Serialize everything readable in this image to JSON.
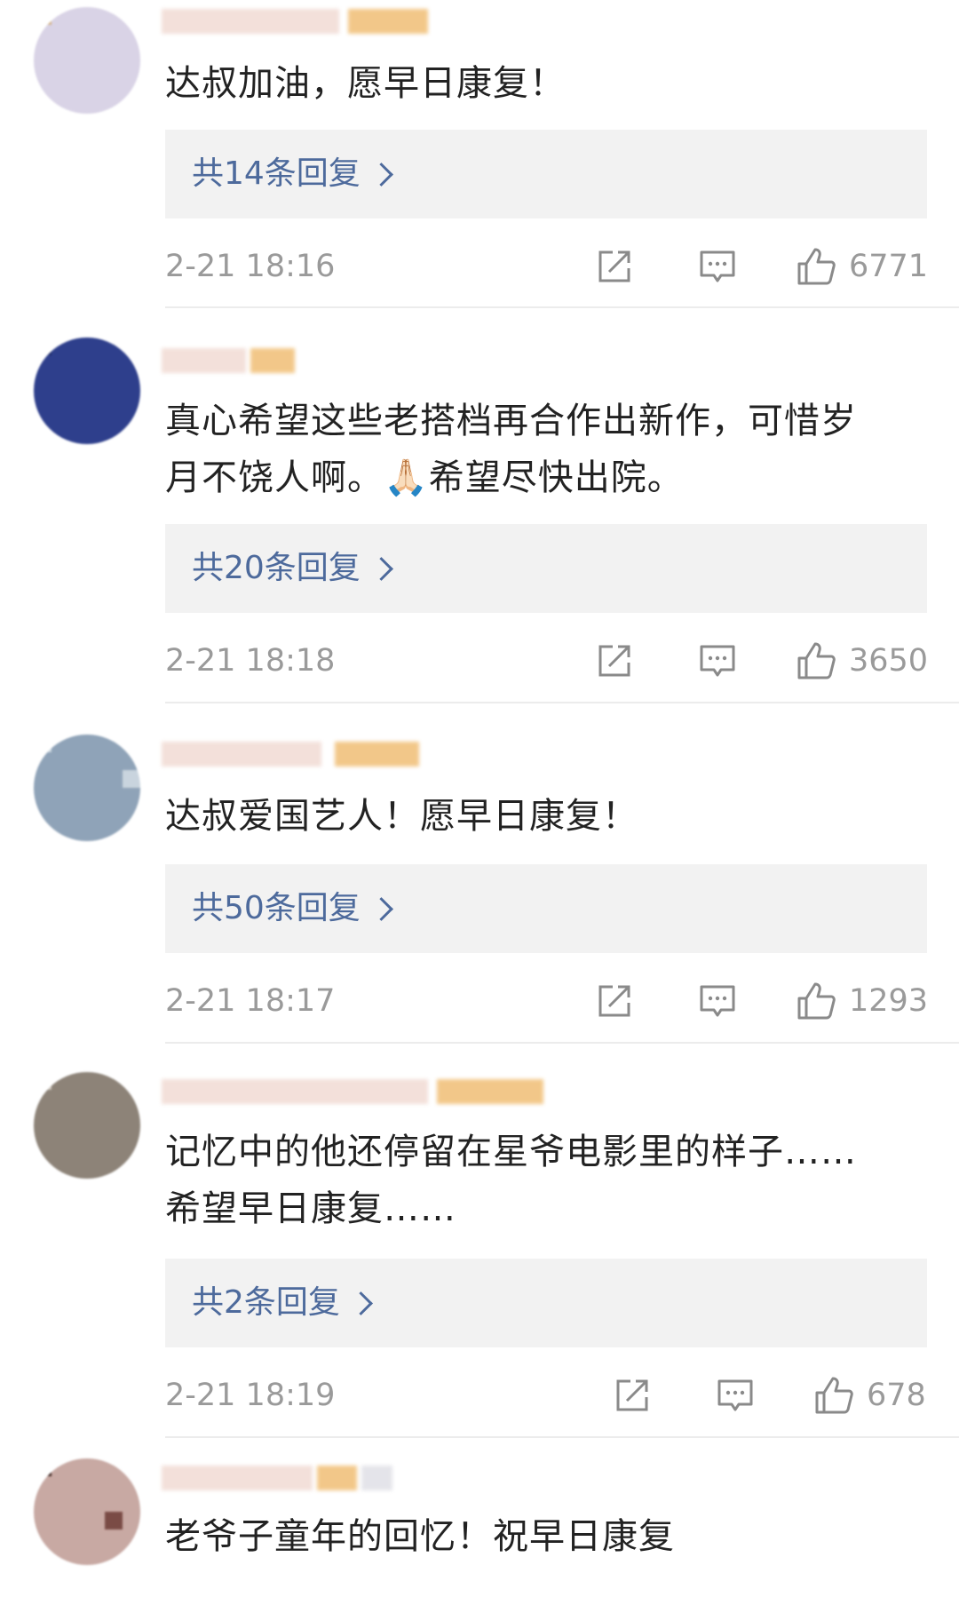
{
  "comments": [
    {
      "text": "达叔加油，愿早日康复！",
      "replies_label": "共14条回复",
      "timestamp": "2-21 18:16",
      "likes": "6771"
    },
    {
      "text": "真心希望这些老搭档再合作出新作，可惜岁\n月不饶人啊。🙏🏻希望尽快出院。",
      "replies_label": "共20条回复",
      "timestamp": "2-21 18:18",
      "likes": "3650"
    },
    {
      "text": "达叔爱国艺人！愿早日康复！",
      "replies_label": "共50条回复",
      "timestamp": "2-21 18:17",
      "likes": "1293"
    },
    {
      "text": "记忆中的他还停留在星爷电影里的样子……\n希望早日康复……",
      "replies_label": "共2条回复",
      "timestamp": "2-21 18:19",
      "likes": "678"
    },
    {
      "text": "老爷子童年的回忆！祝早日康复",
      "replies_label": "",
      "timestamp": "",
      "likes": ""
    }
  ],
  "icons": {
    "forward": "forward-icon",
    "comment": "comment-icon",
    "like": "like-icon",
    "reply_chevron": "chevron-right-icon"
  },
  "colors": {
    "reply_link": "#4d6a9c",
    "reply_box_bg": "#f2f2f2",
    "meta_gray": "#9a9a9a",
    "text": "#222222"
  }
}
